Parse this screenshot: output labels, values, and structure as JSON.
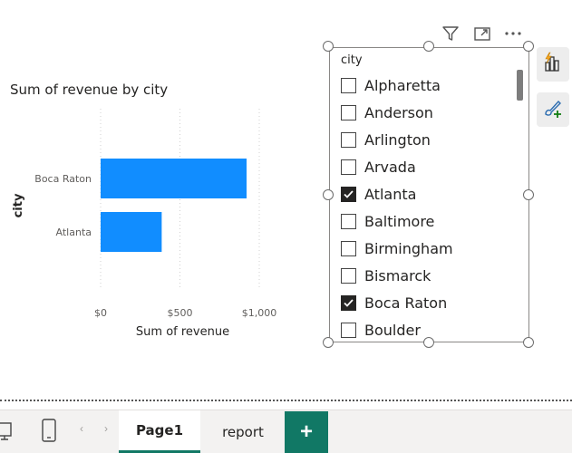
{
  "chart": {
    "title": "Sum of revenue by city"
  },
  "chart_data": {
    "type": "bar",
    "orientation": "horizontal",
    "title": "Sum of revenue by city",
    "xlabel": "Sum of revenue",
    "ylabel": "city",
    "categories": [
      "Boca Raton",
      "Atlanta"
    ],
    "values": [
      920,
      385
    ],
    "xlim": [
      0,
      1000
    ],
    "xticks": [
      0,
      500,
      1000
    ],
    "xtick_labels": [
      "$0",
      "$500",
      "$1,000"
    ],
    "grid": true,
    "color": "#118DFF"
  },
  "slicer": {
    "title": "city",
    "items": [
      {
        "label": "Alpharetta",
        "checked": false
      },
      {
        "label": "Anderson",
        "checked": false
      },
      {
        "label": "Arlington",
        "checked": false
      },
      {
        "label": "Arvada",
        "checked": false
      },
      {
        "label": "Atlanta",
        "checked": true
      },
      {
        "label": "Baltimore",
        "checked": false
      },
      {
        "label": "Birmingham",
        "checked": false
      },
      {
        "label": "Bismarck",
        "checked": false
      },
      {
        "label": "Boca Raton",
        "checked": true
      },
      {
        "label": "Boulder",
        "checked": false
      }
    ]
  },
  "header_icons": [
    "filter-icon",
    "focus-mode-icon",
    "more-options-icon"
  ],
  "side_buttons": [
    "build-visual-icon",
    "format-visual-icon"
  ],
  "tabs": {
    "items": [
      {
        "label": "Page1",
        "active": true
      },
      {
        "label": "report",
        "active": false
      }
    ],
    "add_label": "+"
  },
  "colors": {
    "accent": "#117865",
    "bar": "#118DFF"
  }
}
